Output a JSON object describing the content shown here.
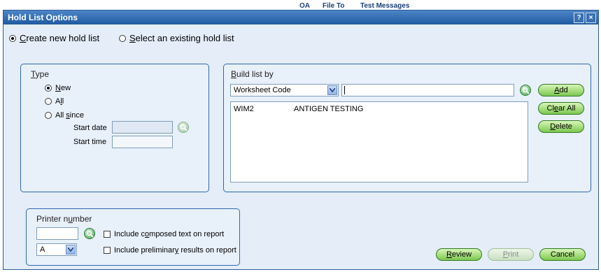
{
  "top_tabs": [
    "OA",
    "File To",
    "Test Messages"
  ],
  "window": {
    "title": "Hold List Options",
    "help_label": "?",
    "close_label": "×"
  },
  "mode": {
    "create_pre": "",
    "create_key": "C",
    "create_post": "reate new hold list",
    "select_pre": "",
    "select_key": "S",
    "select_post": "elect an existing hold list",
    "selected": "create"
  },
  "type_panel": {
    "title_key": "T",
    "title_post": "ype",
    "new_key": "N",
    "new_post": "ew",
    "all_pre": "A",
    "all_key": "l",
    "all_post": "l",
    "since_pre": "All ",
    "since_key": "s",
    "since_post": "ince",
    "start_date_label": "Start date",
    "start_time_label": "Start time",
    "start_date_value": "",
    "start_time_value": "",
    "selected": "new"
  },
  "build_panel": {
    "title_key": "B",
    "title_post": "uild list by",
    "selected_option": "Worksheet Code",
    "search_value": "",
    "add_key": "A",
    "add_post": "dd",
    "clear_pre": "Cl",
    "clear_key": "e",
    "clear_post": "ar All",
    "delete_key": "D",
    "delete_post": "elete",
    "items": [
      {
        "code": "WIM2",
        "description": "ANTIGEN TESTING"
      }
    ]
  },
  "printer_panel": {
    "title_pre": "Printer n",
    "title_key": "u",
    "title_post": "mber",
    "printer_value": "",
    "selected_tray": "A",
    "composed_pre": "Include c",
    "composed_key": "o",
    "composed_post": "mposed text on report",
    "prelim_pre": "Include preliminar",
    "prelim_key": "y",
    "prelim_post": " results on report"
  },
  "buttons": {
    "review_key": "R",
    "review_post": "eview",
    "print_key": "P",
    "print_post": "rint",
    "cancel_label": "Cancel"
  },
  "colors": {
    "title_bar": "#1f5aa1",
    "panel_border": "#2f67b0",
    "dialog_bg": "#e4edf8",
    "button_green": "#7cc84e"
  }
}
